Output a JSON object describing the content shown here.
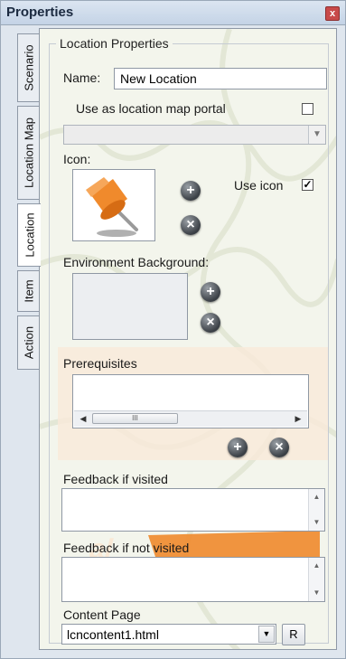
{
  "window": {
    "title": "Properties"
  },
  "tabs": [
    {
      "label": "Scenario"
    },
    {
      "label": "Location Map"
    },
    {
      "label": "Location"
    },
    {
      "label": "Item"
    },
    {
      "label": "Action"
    }
  ],
  "group": {
    "title": "Location Properties"
  },
  "name": {
    "label": "Name:",
    "value": "New Location"
  },
  "portal": {
    "label": "Use as location map portal",
    "checked": false
  },
  "icon": {
    "label": "Icon:",
    "use_icon_label": "Use icon",
    "use_icon_checked": true
  },
  "background": {
    "label": "Environment Background:"
  },
  "prerequisites": {
    "label": "Prerequisites",
    "scroll_thumb": "III"
  },
  "feedback_visited": {
    "label": "Feedback if visited",
    "value": ""
  },
  "feedback_not_visited": {
    "label": "Feedback if not visited",
    "value": ""
  },
  "content_page": {
    "label": "Content Page",
    "value": "lcncontent1.html",
    "button_label": "R"
  },
  "glyphs": {
    "check": "✓",
    "close": "x",
    "add": "+",
    "remove": "×",
    "arrow_down": "▼",
    "arrow_up": "▲",
    "arrow_left": "◀",
    "arrow_right": "▶"
  },
  "colors": {
    "accent_orange": "#f08a2c",
    "panel_bg": "#f3f5ec"
  }
}
